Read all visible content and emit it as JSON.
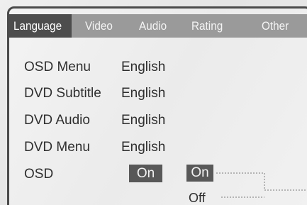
{
  "tabs": [
    {
      "label": "Language",
      "active": true
    },
    {
      "label": "Video",
      "active": false
    },
    {
      "label": "Audio",
      "active": false
    },
    {
      "label": "Rating",
      "active": false
    },
    {
      "label": "Other",
      "active": false
    }
  ],
  "settings": [
    {
      "label": "OSD Menu",
      "value": "English"
    },
    {
      "label": "DVD Subtitle",
      "value": "English"
    },
    {
      "label": "DVD Audio",
      "value": "English"
    },
    {
      "label": "DVD Menu",
      "value": "English"
    },
    {
      "label": "OSD",
      "value": "On"
    }
  ],
  "osd_options": [
    "On",
    "Off"
  ],
  "colors": {
    "tab_bar": "#9a9a9a",
    "tab_active": "#4d4d4d",
    "chip": "#585858"
  }
}
